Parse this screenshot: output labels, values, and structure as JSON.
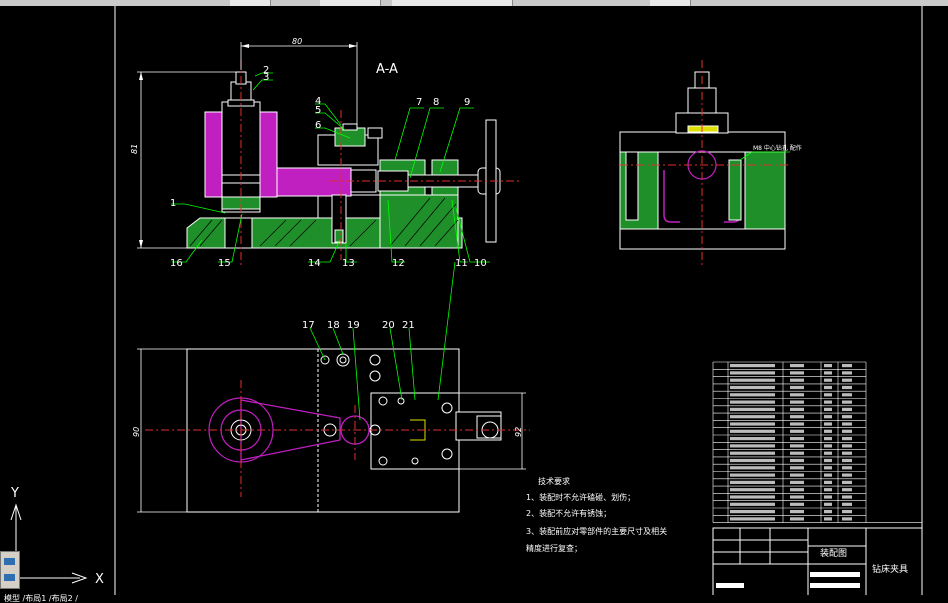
{
  "toolbar": {
    "buttons": [
      "",
      "",
      "",
      ""
    ]
  },
  "section_label": "A-A",
  "dimensions": {
    "top_width": "80",
    "left_height": "81",
    "plan_height": "90",
    "plan_right": "92"
  },
  "part_numbers": {
    "p1": "1",
    "p2": "2",
    "p3": "3",
    "p4": "4",
    "p5": "5",
    "p6": "6",
    "p7": "7",
    "p8": "8",
    "p9": "9",
    "p10": "10",
    "p11": "11",
    "p12": "12",
    "p13": "13",
    "p14": "14",
    "p15": "15",
    "p16": "16",
    "p17": "17",
    "p18": "18",
    "p19": "19",
    "p20": "20",
    "p21": "21"
  },
  "side_note": "M8 中心钻孔\n配作",
  "tech_requirements": {
    "heading": "技术要求",
    "lines": [
      "1、装配时不允许磕碰、划伤；",
      "2、装配不允许有锈蚀；",
      "3、装配前应对零部件的主要尺寸及相关",
      "精度进行复查；"
    ]
  },
  "title_block": {
    "drawing_name": "装配图",
    "product_name": "钻床夹具"
  },
  "axes": {
    "y": "Y",
    "x": "X"
  },
  "statusbar": "模型 /布局1 /布局2 /"
}
